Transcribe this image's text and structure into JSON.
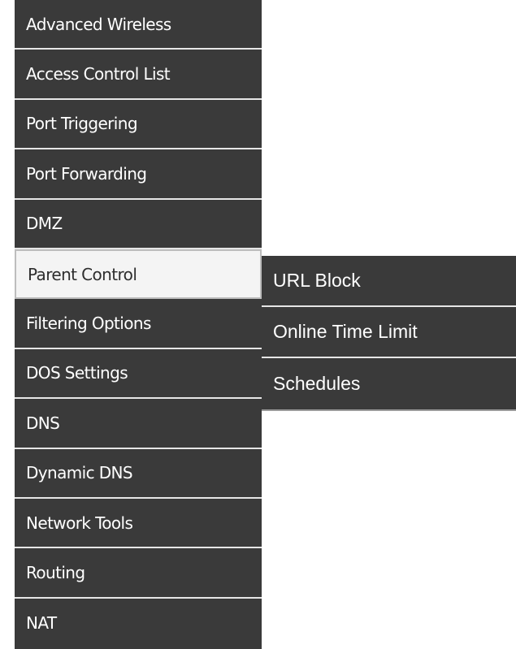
{
  "sidebar": {
    "items": [
      {
        "label": "Advanced Wireless"
      },
      {
        "label": "Access Control List"
      },
      {
        "label": "Port Triggering"
      },
      {
        "label": "Port Forwarding"
      },
      {
        "label": "DMZ"
      },
      {
        "label": "Parent Control",
        "active": true
      },
      {
        "label": "Filtering Options"
      },
      {
        "label": "DOS Settings"
      },
      {
        "label": "DNS"
      },
      {
        "label": "Dynamic DNS"
      },
      {
        "label": "Network Tools"
      },
      {
        "label": "Routing"
      },
      {
        "label": "NAT"
      }
    ]
  },
  "submenu": {
    "items": [
      {
        "label": "URL Block"
      },
      {
        "label": "Online Time Limit"
      },
      {
        "label": "Schedules"
      }
    ]
  },
  "colors": {
    "menu_bg": "#3a3a3a",
    "menu_text": "#ffffff",
    "active_bg": "#f4f4f4",
    "active_text": "#2e2e2e",
    "divider": "#e6e6e6"
  }
}
